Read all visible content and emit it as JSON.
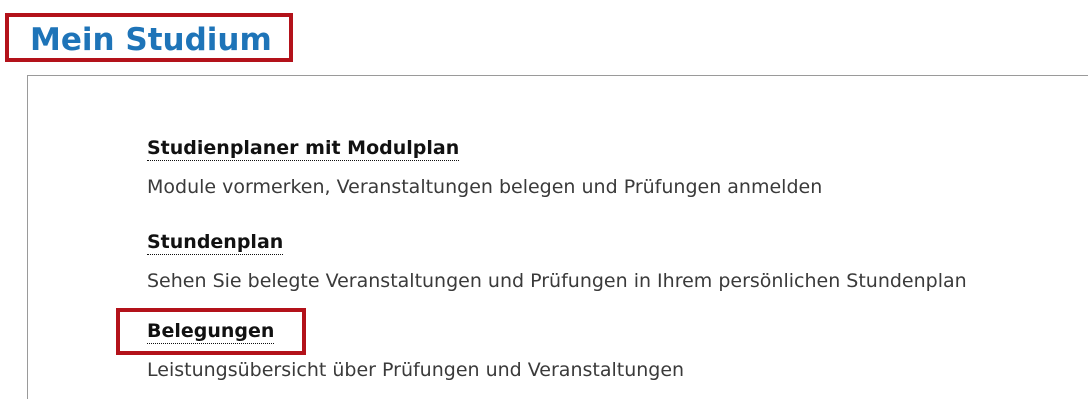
{
  "page_title": "Mein Studium",
  "entries": [
    {
      "link": "Studienplaner mit Modulplan",
      "description": "Module vormerken, Veranstaltungen belegen und Prüfungen anmelden"
    },
    {
      "link": "Stundenplan",
      "description": "Sehen Sie belegte Veranstaltungen und Prüfungen in Ihrem persönlichen Stundenplan"
    },
    {
      "link": "Belegungen",
      "description": "Leistungsübersicht über Prüfungen und Veranstaltungen"
    }
  ],
  "colors": {
    "title": "#1e74b8",
    "highlight_border": "#b3121a",
    "panel_border": "#9a9a9a"
  }
}
